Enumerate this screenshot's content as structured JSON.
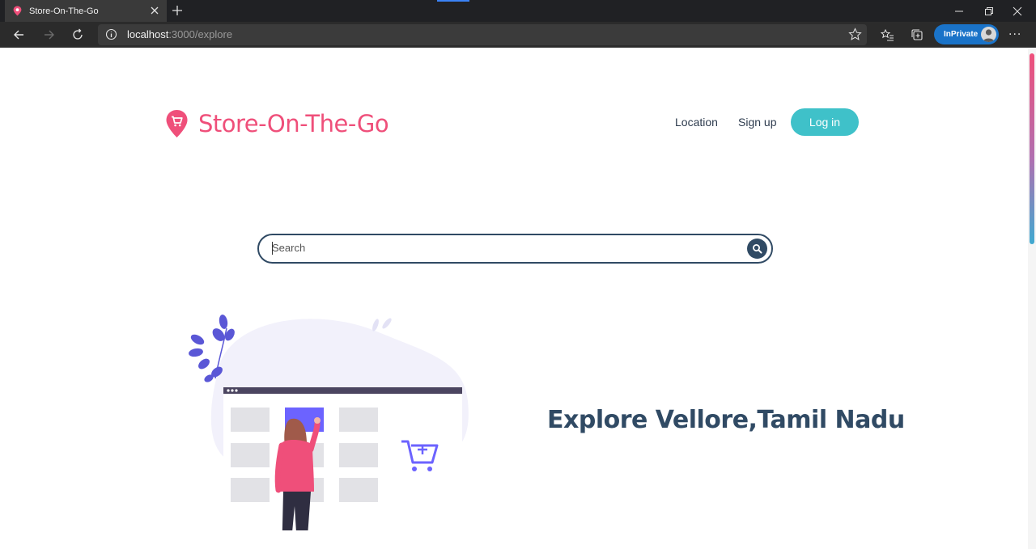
{
  "browser": {
    "tab_title": "Store-On-The-Go",
    "url_host": "localhost",
    "url_rest": ":3000/explore",
    "inprivate_label": "InPrivate",
    "more_label": "···"
  },
  "site": {
    "brand_name": "Store-On-The-Go",
    "nav": {
      "location": "Location",
      "signup": "Sign up",
      "login": "Log in"
    },
    "search": {
      "placeholder": "Search"
    },
    "hero_title": "Explore Vellore,Tamil Nadu"
  },
  "colors": {
    "brand_pink": "#ef4f7a",
    "login_teal": "#3fc1c9",
    "navy": "#304a64",
    "illustration_purple": "#6c63ff"
  },
  "icons": [
    "location-pin-cart-icon",
    "search-icon",
    "shopping-cart-plus-icon"
  ]
}
